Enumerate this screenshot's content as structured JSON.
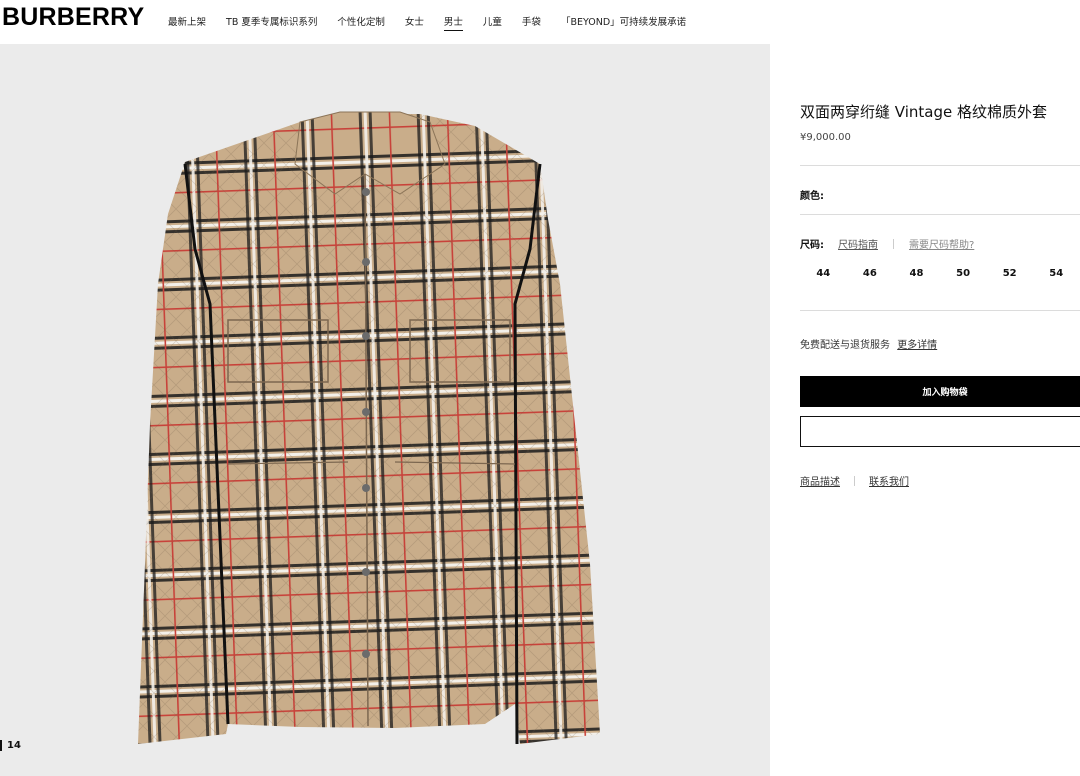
{
  "header": {
    "logo": "BURBERRY",
    "nav": [
      "最新上架",
      "TB 夏季专属标识系列",
      "个性化定制",
      "女士",
      "男士",
      "儿童",
      "手袋",
      "「BEYOND」可持续发展承诺"
    ],
    "active_nav": "男士"
  },
  "gallery": {
    "counter": "14",
    "image_subject": "vintage-check-quilted-jacket"
  },
  "product": {
    "title": "双面两穿绗缝 Vintage 格纹棉质外套",
    "price": "¥9,000.00",
    "color_label": "颜色:",
    "size_label": "尺码:",
    "size_guide": "尺码指南",
    "size_help": "需要尺码帮助?",
    "sizes": [
      "44",
      "46",
      "48",
      "50",
      "52",
      "54"
    ],
    "shipping_text": "免费配送与退货服务",
    "shipping_more": "更多详情",
    "add_to_bag": "加入购物袋",
    "description_link": "商品描述",
    "contact_link": "联系我们"
  },
  "colors": {
    "accent": "#000000",
    "check_beige": "#c9ad8a",
    "check_red": "#c8423a"
  }
}
